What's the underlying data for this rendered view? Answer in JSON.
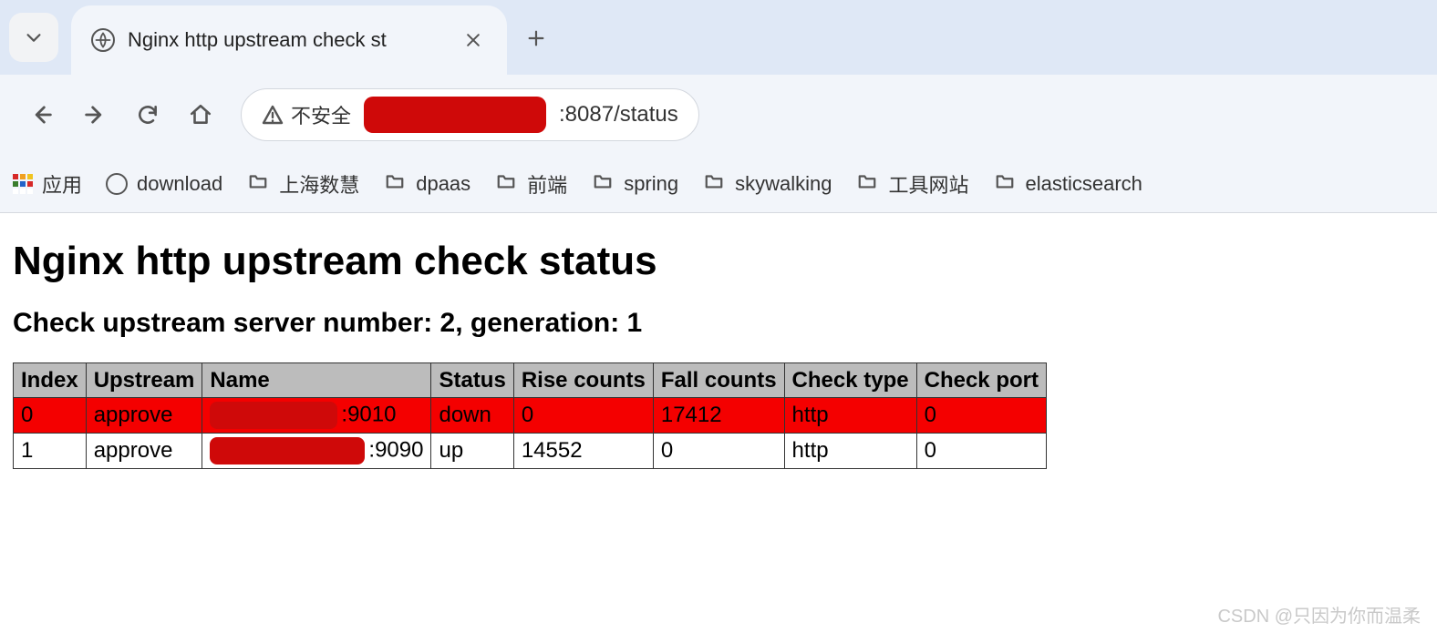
{
  "browser": {
    "tab_title": "Nginx http upstream check st",
    "address": {
      "security_label": "不安全",
      "url_suffix": ":8087/status"
    },
    "bookmarks": {
      "apps": "应用",
      "download": "download",
      "items": [
        "上海数慧",
        "dpaas",
        "前端",
        "spring",
        "skywalking",
        "工具网站",
        "elasticsearch"
      ]
    }
  },
  "page": {
    "h1": "Nginx http upstream check status",
    "h2": "Check upstream server number: 2, generation: 1",
    "table": {
      "headers": [
        "Index",
        "Upstream",
        "Name",
        "Status",
        "Rise counts",
        "Fall counts",
        "Check type",
        "Check port"
      ],
      "rows": [
        {
          "index": "0",
          "upstream": "approve",
          "name_suffix": ":9010",
          "status": "down",
          "rise": "0",
          "fall": "17412",
          "check_type": "http",
          "check_port": "0"
        },
        {
          "index": "1",
          "upstream": "approve",
          "name_suffix": ":9090",
          "status": "up",
          "rise": "14552",
          "fall": "0",
          "check_type": "http",
          "check_port": "0"
        }
      ]
    }
  },
  "watermark": "CSDN @只因为你而温柔"
}
